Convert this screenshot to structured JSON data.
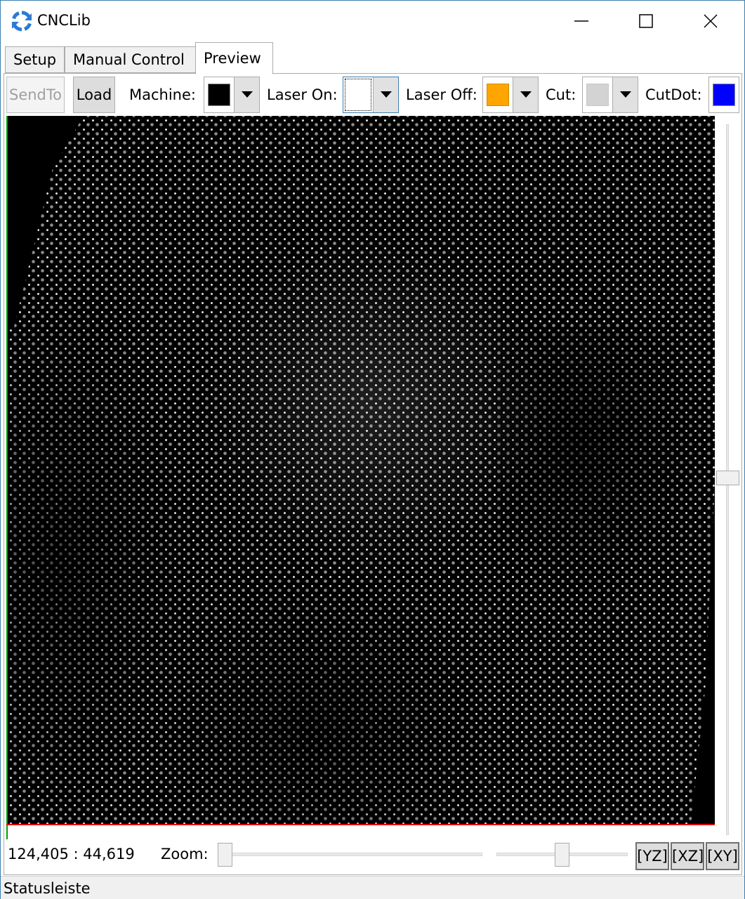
{
  "window": {
    "title": "CNCLib",
    "icon": "refresh-arrows-icon"
  },
  "tabs": [
    {
      "label": "Setup",
      "active": false
    },
    {
      "label": "Manual Control",
      "active": false
    },
    {
      "label": "Preview",
      "active": true
    }
  ],
  "toolbar": {
    "sendto_label": "SendTo",
    "load_label": "Load",
    "machine_label": "Machine:",
    "machine_color": "#000000",
    "laser_on_label": "Laser On:",
    "laser_on_color": "#ffffff",
    "laser_off_label": "Laser Off:",
    "laser_off_color": "#ffa500",
    "cut_label": "Cut:",
    "cut_color": "#d3d3d3",
    "cutdot_label": "CutDot:",
    "cutdot_color": "#0000ff"
  },
  "preview": {
    "background_color": "#000000",
    "point_color": "#ffffff",
    "x_axis_color": "#e00000",
    "y_axis_color": "#00a000"
  },
  "bottom": {
    "coordinates": "124,405 : 44,619",
    "zoom_label": "Zoom:",
    "view_yz": "[YZ]",
    "view_xz": "[XZ]",
    "view_xy": "[XY]"
  },
  "status": {
    "text": "Statusleiste"
  }
}
